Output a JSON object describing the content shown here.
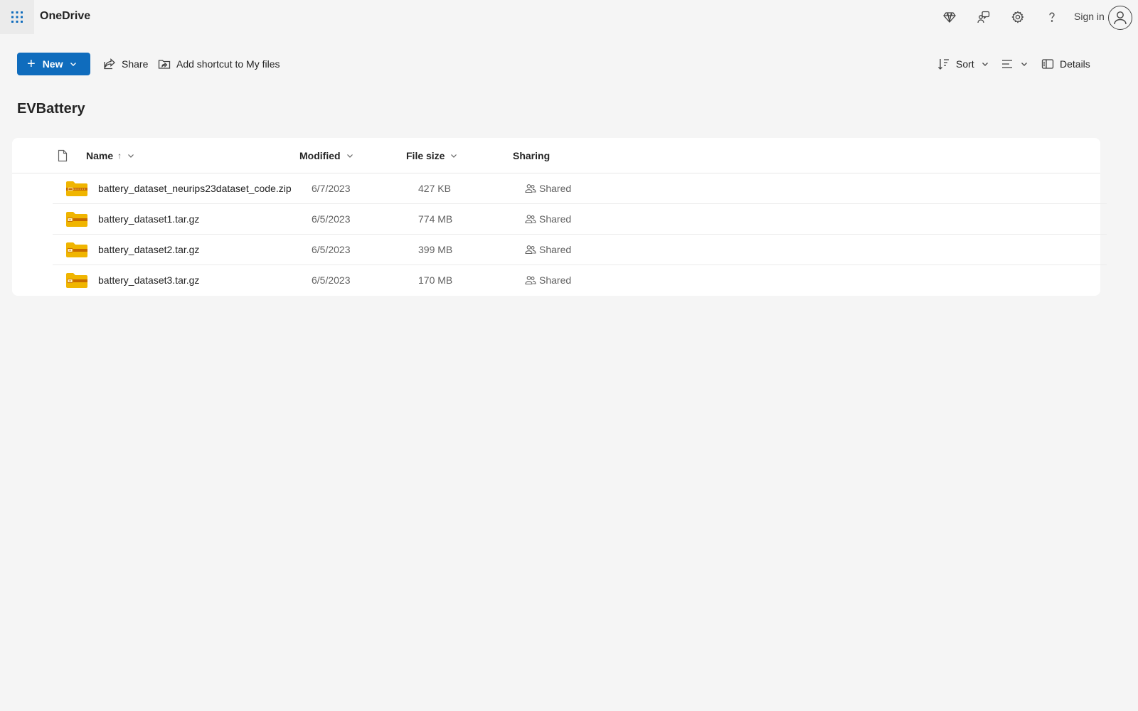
{
  "app": {
    "title": "OneDrive"
  },
  "header": {
    "signin_label": "Sign in",
    "icons": [
      "app-launcher-icon",
      "premium-diamond-icon",
      "feedback-icon",
      "settings-gear-icon",
      "help-icon",
      "account-icon"
    ]
  },
  "toolbar": {
    "new_label": "New",
    "share_label": "Share",
    "shortcut_label": "Add shortcut to My files",
    "sort_label": "Sort",
    "details_label": "Details"
  },
  "folder": {
    "title": "EVBattery"
  },
  "table": {
    "columns": {
      "name": "Name",
      "name_sort_indicator": "↑",
      "modified": "Modified",
      "size": "File size",
      "sharing": "Sharing"
    },
    "rows": [
      {
        "name": "battery_dataset_neurips23dataset_code.zip",
        "modified": "6/7/2023",
        "size": "427 KB",
        "sharing": "Shared",
        "icon": "zip-folder-icon"
      },
      {
        "name": "battery_dataset1.tar.gz",
        "modified": "6/5/2023",
        "size": "774 MB",
        "sharing": "Shared",
        "icon": "archive-folder-icon"
      },
      {
        "name": "battery_dataset2.tar.gz",
        "modified": "6/5/2023",
        "size": "399 MB",
        "sharing": "Shared",
        "icon": "archive-folder-icon"
      },
      {
        "name": "battery_dataset3.tar.gz",
        "modified": "6/5/2023",
        "size": "170 MB",
        "sharing": "Shared",
        "icon": "archive-folder-icon"
      }
    ]
  },
  "colors": {
    "accent": "#0f6cbd",
    "background": "#f5f5f5",
    "folder_yellow": "#f0b500",
    "folder_band": "#c76a00"
  }
}
